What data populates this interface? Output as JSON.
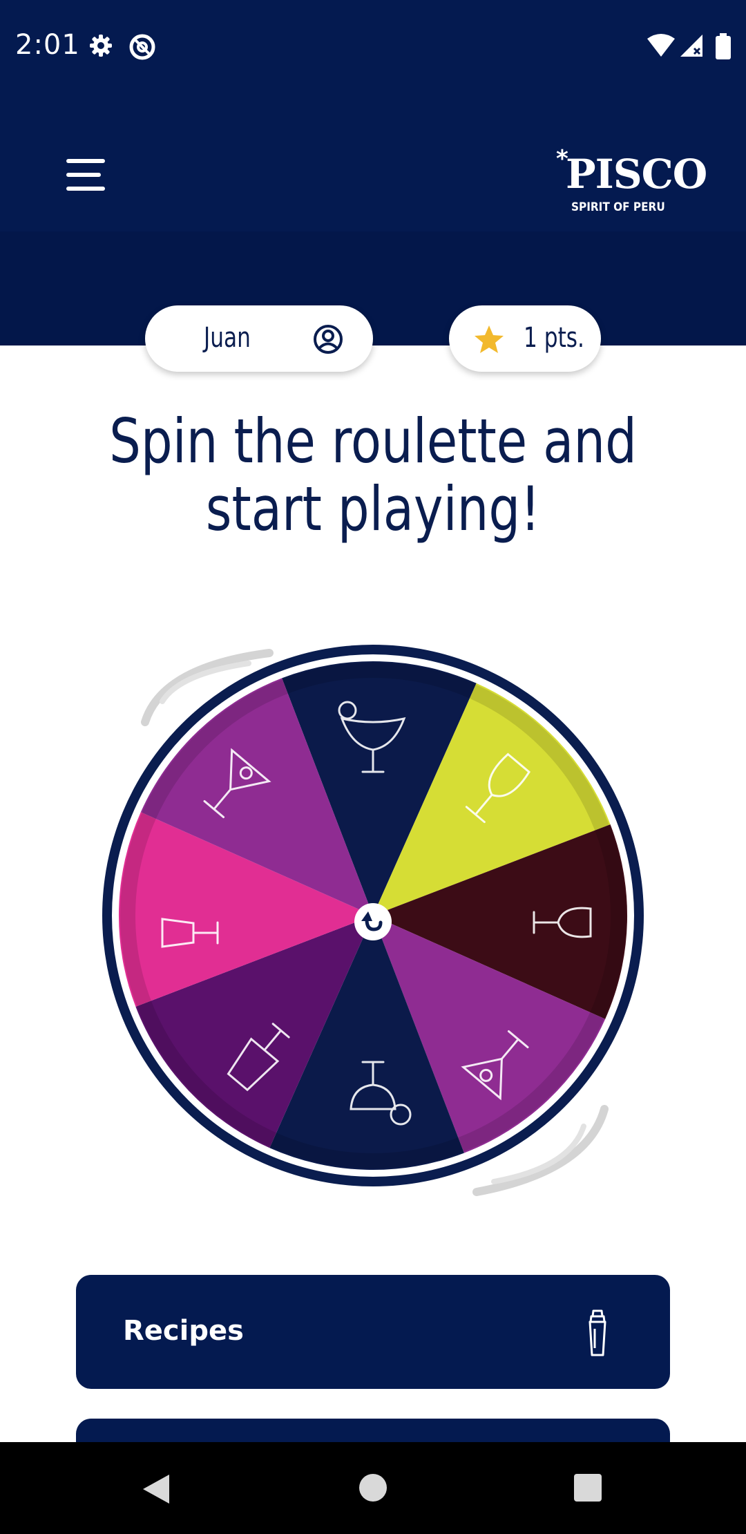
{
  "status_bar": {
    "time": "2:01",
    "icons": [
      "gear-icon",
      "at-sign-icon",
      "wifi-icon",
      "signal-icon",
      "battery-icon"
    ]
  },
  "header": {
    "menu_icon": "hamburger-menu-icon",
    "logo": {
      "name": "PISCO",
      "tagline": "SPIRIT OF PERU",
      "mark": "*"
    },
    "background_color": "#041a50"
  },
  "user_pill": {
    "name": "Juan",
    "icon": "user-circle-icon"
  },
  "points_pill": {
    "label": "1 pts.",
    "icon": "star-icon",
    "star_color": "#f2b92d"
  },
  "headline": {
    "line1": "Spin the roulette and",
    "line2": "start playing!"
  },
  "roulette": {
    "segments": [
      {
        "color": "#0b1a4a",
        "icon": "margarita-glass-icon"
      },
      {
        "color": "#d6dd35",
        "icon": "wine-glass-icon"
      },
      {
        "color": "#3c0c16",
        "icon": "tipped-wine-glass-icon"
      },
      {
        "color": "#8f2c92",
        "icon": "martini-glass-icon"
      },
      {
        "color": "#0b1a4a",
        "icon": "cocktail-shaker-icon"
      },
      {
        "color": "#5a116b",
        "icon": "tumbler-glass-icon"
      },
      {
        "color": "#e12e93",
        "icon": "sideways-glass-icon"
      },
      {
        "color": "#8f2c92",
        "icon": "martini-glass-icon"
      }
    ],
    "spin_icon": "spin-arrow-icon",
    "rim_color": "#0a1d4f"
  },
  "nav_cards": [
    {
      "label": "Recipes",
      "icon": "cocktail-shaker-icon"
    }
  ],
  "system_nav": {
    "back": "back-icon",
    "home": "home-icon",
    "recents": "recents-icon"
  }
}
